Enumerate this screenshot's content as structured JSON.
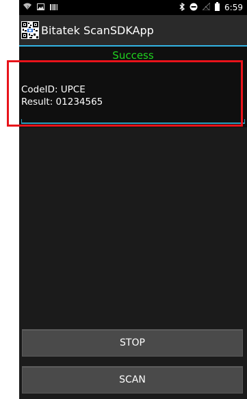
{
  "status_bar": {
    "time": "6:59",
    "icons": [
      "wifi-icon",
      "image-icon",
      "barcode-notif-icon",
      "bluetooth-icon",
      "do-not-disturb-icon",
      "no-signal-icon",
      "battery-icon"
    ]
  },
  "app_bar": {
    "title": "Bitatek ScanSDKApp",
    "icon": "qr-code-icon",
    "accent_color": "#33b5e5"
  },
  "result": {
    "status": "Success",
    "status_color": "#1fd41f",
    "code_id": "CodeID: UPCE",
    "result": "Result: 01234565"
  },
  "buttons": {
    "stop_label": "STOP",
    "scan_label": "SCAN"
  },
  "highlight_color": "#e8131a"
}
